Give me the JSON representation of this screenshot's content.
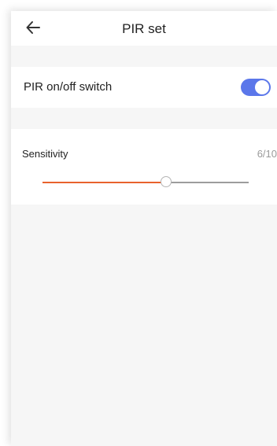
{
  "header": {
    "title": "PIR set",
    "back_icon": "arrow-left-icon"
  },
  "pir_switch": {
    "label": "PIR on/off switch",
    "on": true,
    "accent_color": "#5b77ea"
  },
  "sensitivity": {
    "label": "Sensitivity",
    "value_text": "6/10",
    "value": 6,
    "max": 10,
    "fill_color": "#e8622d"
  }
}
